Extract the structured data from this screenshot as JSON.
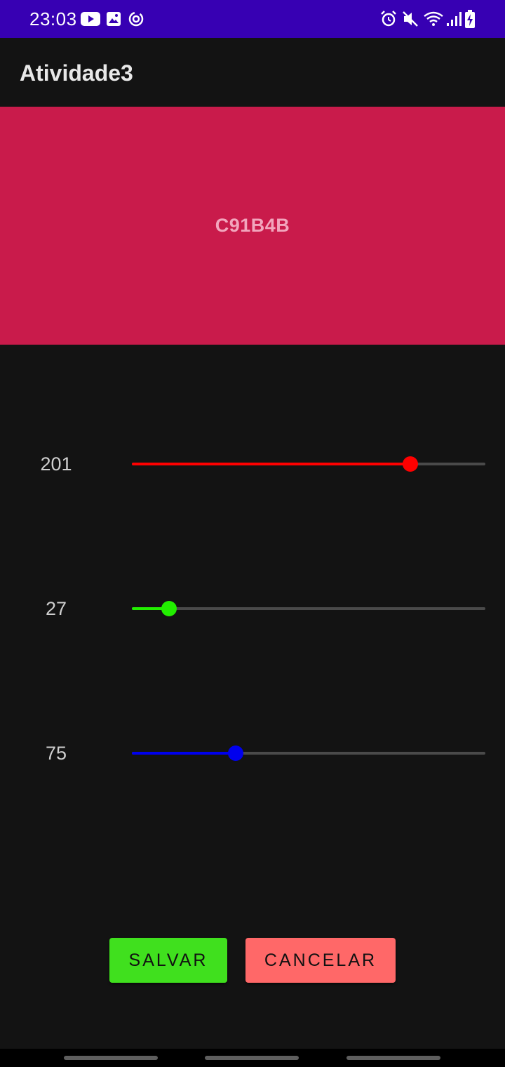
{
  "status_bar": {
    "time": "23:03",
    "background": "#3700b3",
    "left_icons": [
      "youtube-icon",
      "gallery-icon",
      "sync-icon"
    ],
    "right_icons": [
      "alarm-icon",
      "mute-icon",
      "wifi-icon",
      "signal-icon",
      "battery-charging-icon"
    ]
  },
  "app_bar": {
    "title": "Atividade3"
  },
  "preview": {
    "hex_label": "C91B4B",
    "color": "#c91b4b"
  },
  "sliders": [
    {
      "name": "red",
      "value_label": "201",
      "value": 201,
      "max": 255,
      "color": "#ff0000"
    },
    {
      "name": "green",
      "value_label": "27",
      "value": 27,
      "max": 255,
      "color": "#22ee00"
    },
    {
      "name": "blue",
      "value_label": "75",
      "value": 75,
      "max": 255,
      "color": "#0000ee"
    }
  ],
  "buttons": {
    "save_label": "SALVAR",
    "save_color": "#40e01e",
    "cancel_label": "CANCELAR",
    "cancel_color": "#ff6868"
  }
}
